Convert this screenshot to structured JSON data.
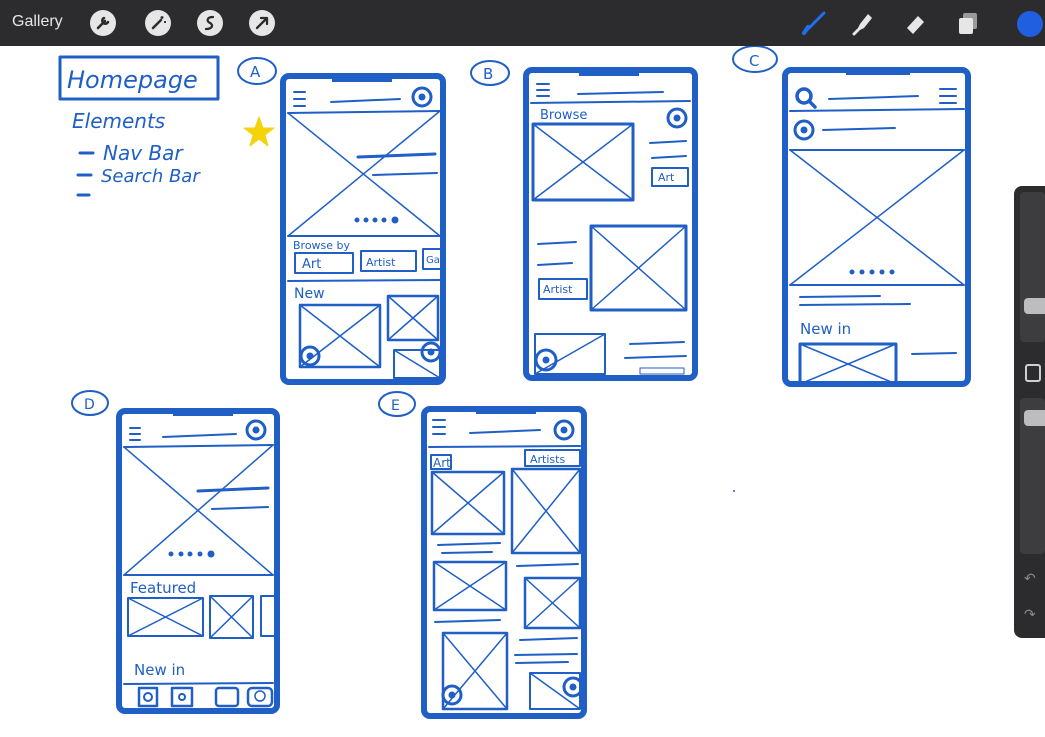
{
  "toolbar": {
    "gallery_label": "Gallery",
    "left_tools": [
      "wrench-icon",
      "magic-wand-icon",
      "selection-icon",
      "transform-arrow-icon"
    ],
    "right_tools": [
      "brush-icon",
      "smudge-icon",
      "eraser-icon",
      "layers-icon"
    ],
    "active_color": "#1f5fe0"
  },
  "sketch": {
    "ink_color": "#1f5fc6",
    "star_color": "#f5d20a",
    "title": "Homepage",
    "elements_heading": "Elements",
    "elements_items": [
      "Nav Bar",
      "Search Bar",
      ""
    ],
    "wireframes": [
      {
        "id": "A",
        "texts": [
          "Browse by",
          "Art",
          "Artist",
          "Gall",
          "New"
        ]
      },
      {
        "id": "B",
        "texts": [
          "Browse",
          "Art",
          "Artist"
        ]
      },
      {
        "id": "C",
        "texts": [
          "New in"
        ]
      },
      {
        "id": "D",
        "texts": [
          "Featured",
          "New in"
        ]
      },
      {
        "id": "E",
        "texts": [
          "Art",
          "Artists"
        ]
      }
    ]
  },
  "sidebar": {
    "controls": [
      "brush-size-slider",
      "modify-button",
      "opacity-slider",
      "undo-icon",
      "redo-icon"
    ]
  }
}
